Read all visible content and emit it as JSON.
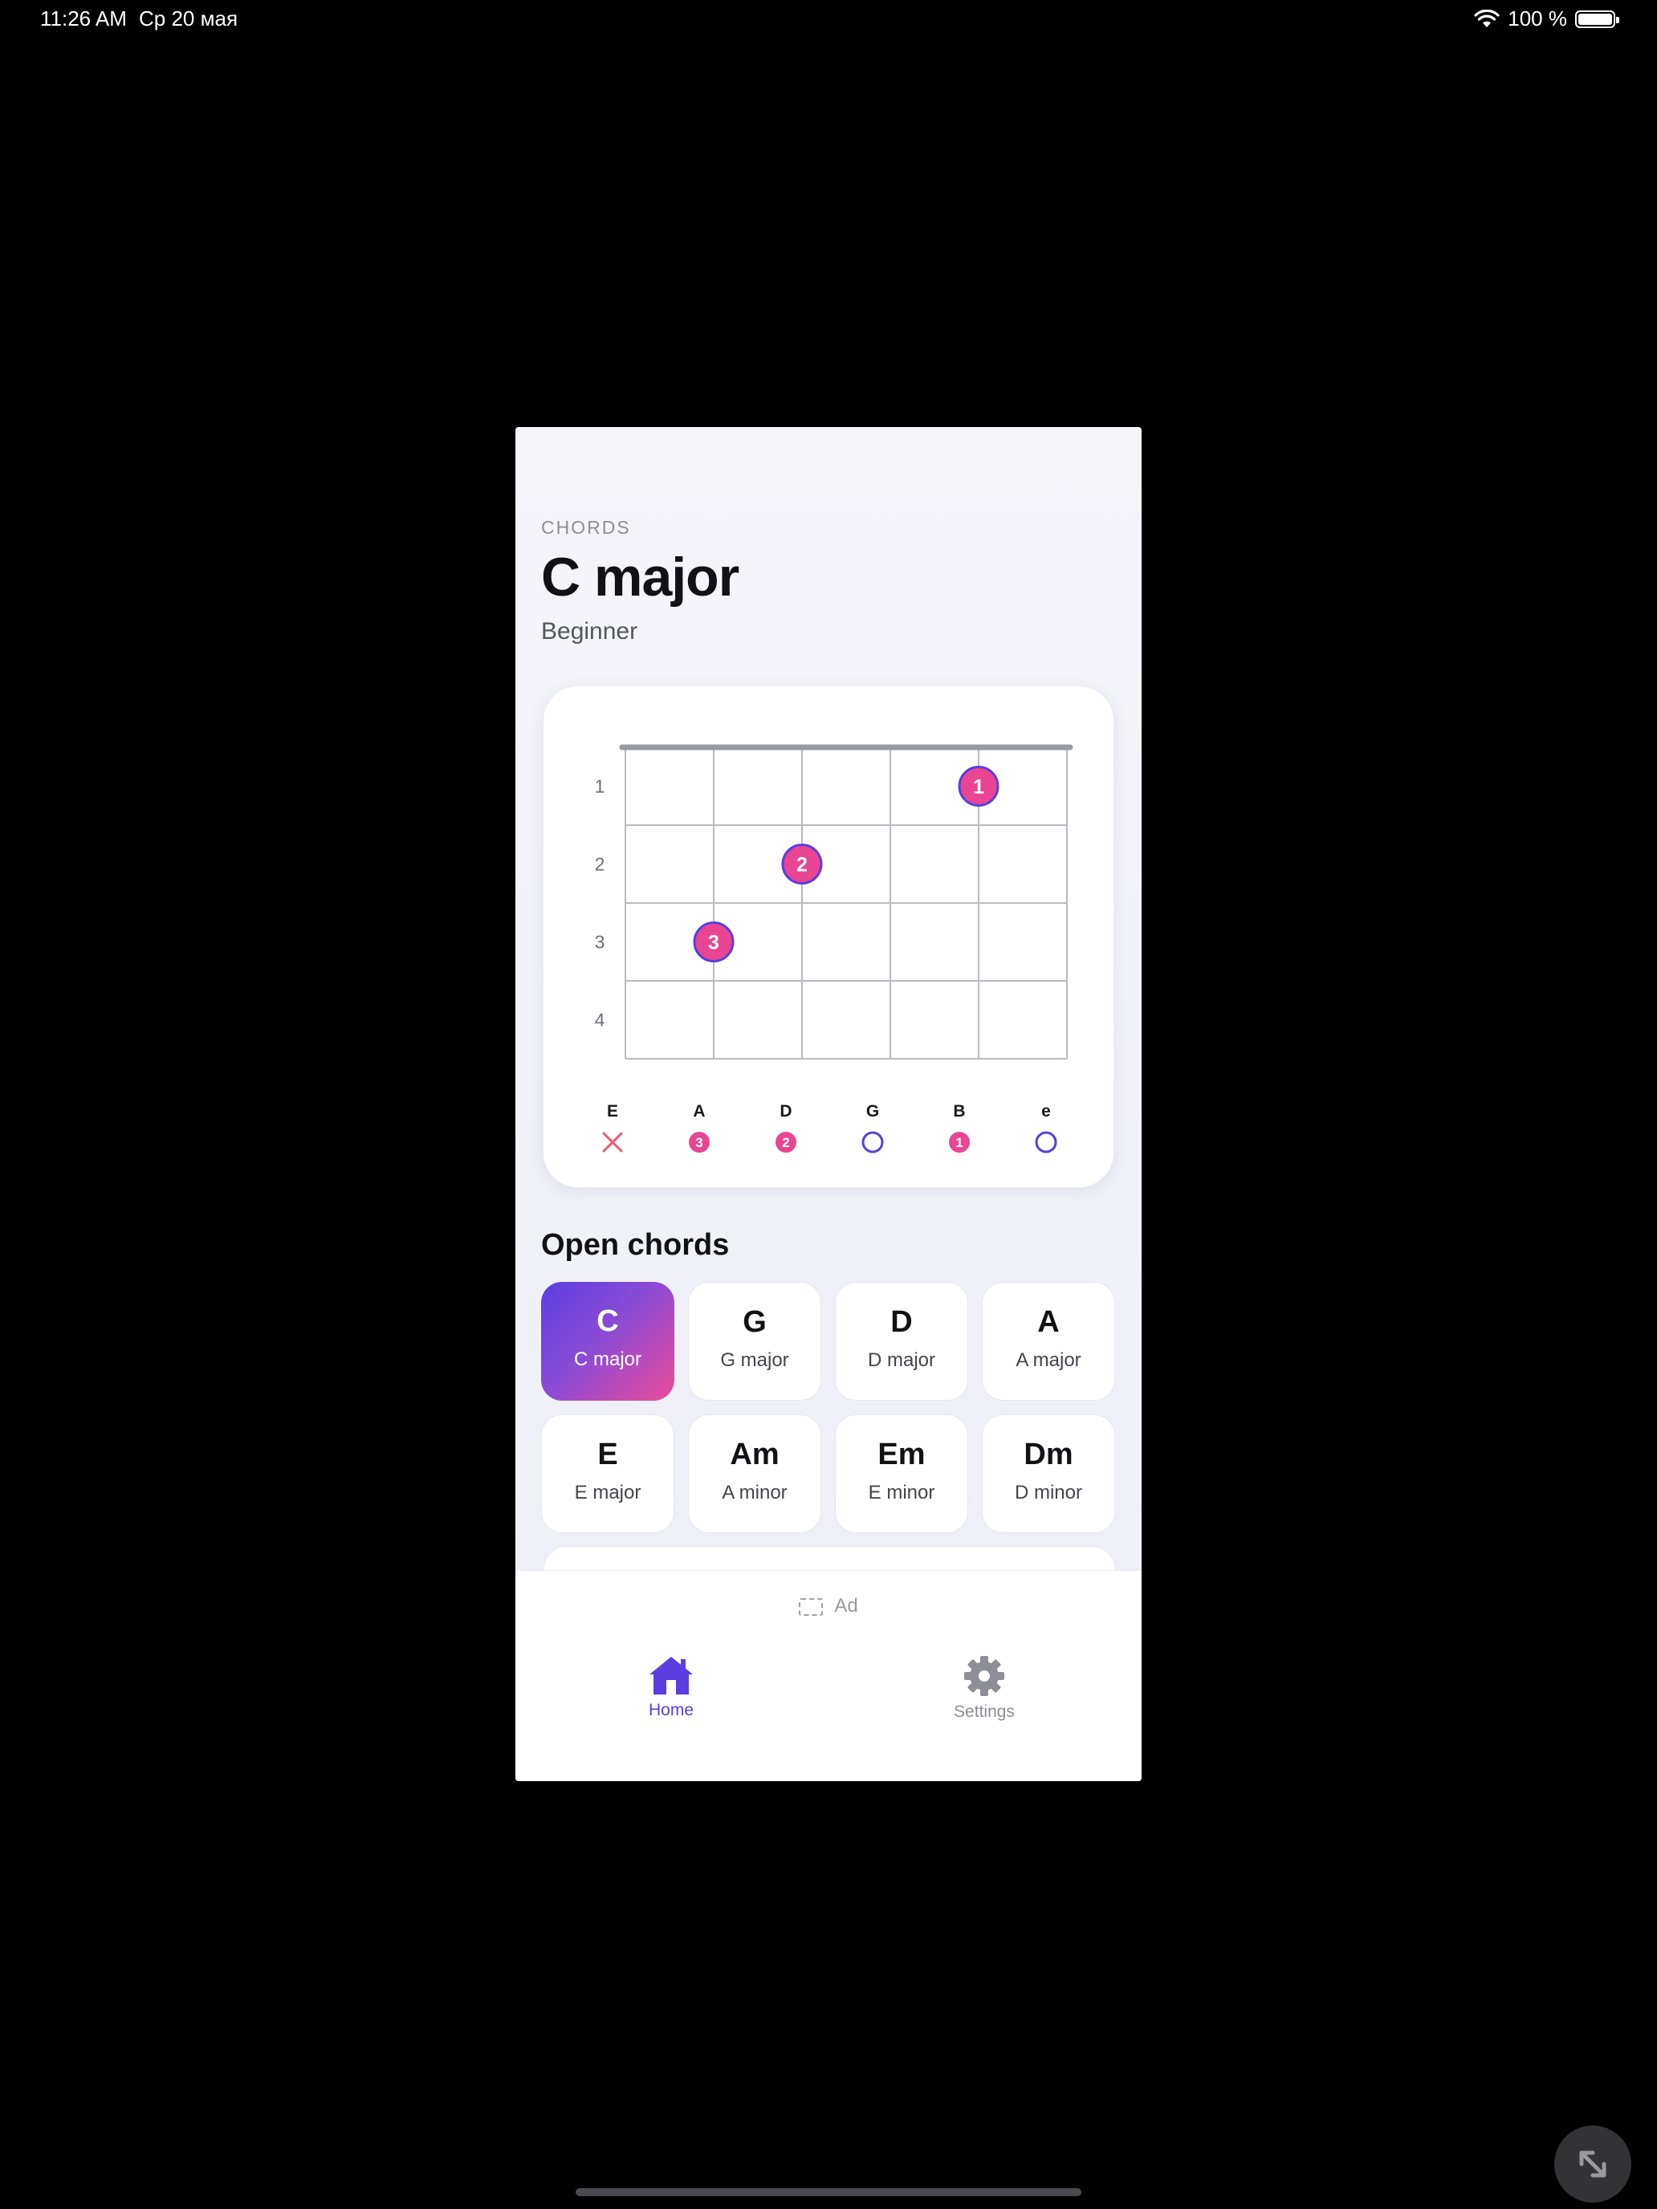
{
  "status_bar": {
    "time": "11:26 AM",
    "date": "Ср 20 мая",
    "battery": "100 %",
    "battery_level": 1.0
  },
  "header": {
    "eyebrow": "CHORDS",
    "title": "C major",
    "level": "Beginner"
  },
  "diagram": {
    "fret_numbers": [
      "1",
      "2",
      "3",
      "4"
    ],
    "strings": [
      {
        "name": "E",
        "state": "muted",
        "finger": ""
      },
      {
        "name": "A",
        "state": "finger",
        "finger": "3"
      },
      {
        "name": "D",
        "state": "finger",
        "finger": "2"
      },
      {
        "name": "G",
        "state": "open",
        "finger": ""
      },
      {
        "name": "B",
        "state": "finger",
        "finger": "1"
      },
      {
        "name": "e",
        "state": "open",
        "finger": ""
      }
    ],
    "dots": [
      {
        "string": 4,
        "fret": 1,
        "label": "1"
      },
      {
        "string": 2,
        "fret": 2,
        "label": "2"
      },
      {
        "string": 1,
        "fret": 3,
        "label": "3"
      }
    ],
    "colors": {
      "dot": "#ea4592",
      "dot_ring": "#5a3ee0",
      "open": "#5a3ee0",
      "muted": "#f05a6e",
      "grid": "#b9b9c6",
      "nut": "#999aa2"
    }
  },
  "section_title": "Open chords",
  "chords": [
    {
      "symbol": "C",
      "name": "C major",
      "active": true
    },
    {
      "symbol": "G",
      "name": "G major",
      "active": false
    },
    {
      "symbol": "D",
      "name": "D major",
      "active": false
    },
    {
      "symbol": "A",
      "name": "A major",
      "active": false
    },
    {
      "symbol": "E",
      "name": "E major",
      "active": false
    },
    {
      "symbol": "Am",
      "name": "A minor",
      "active": false
    },
    {
      "symbol": "Em",
      "name": "E minor",
      "active": false
    },
    {
      "symbol": "Dm",
      "name": "D minor",
      "active": false
    }
  ],
  "ad_label": "Ad",
  "tabs": {
    "home": "Home",
    "settings": "Settings"
  },
  "icons": {
    "home": "home-icon",
    "settings": "gear-icon",
    "expand": "expand-icon",
    "wifi": "wifi-icon",
    "ad": "ad-placeholder-icon"
  },
  "accent_color": "#5a3ee0"
}
